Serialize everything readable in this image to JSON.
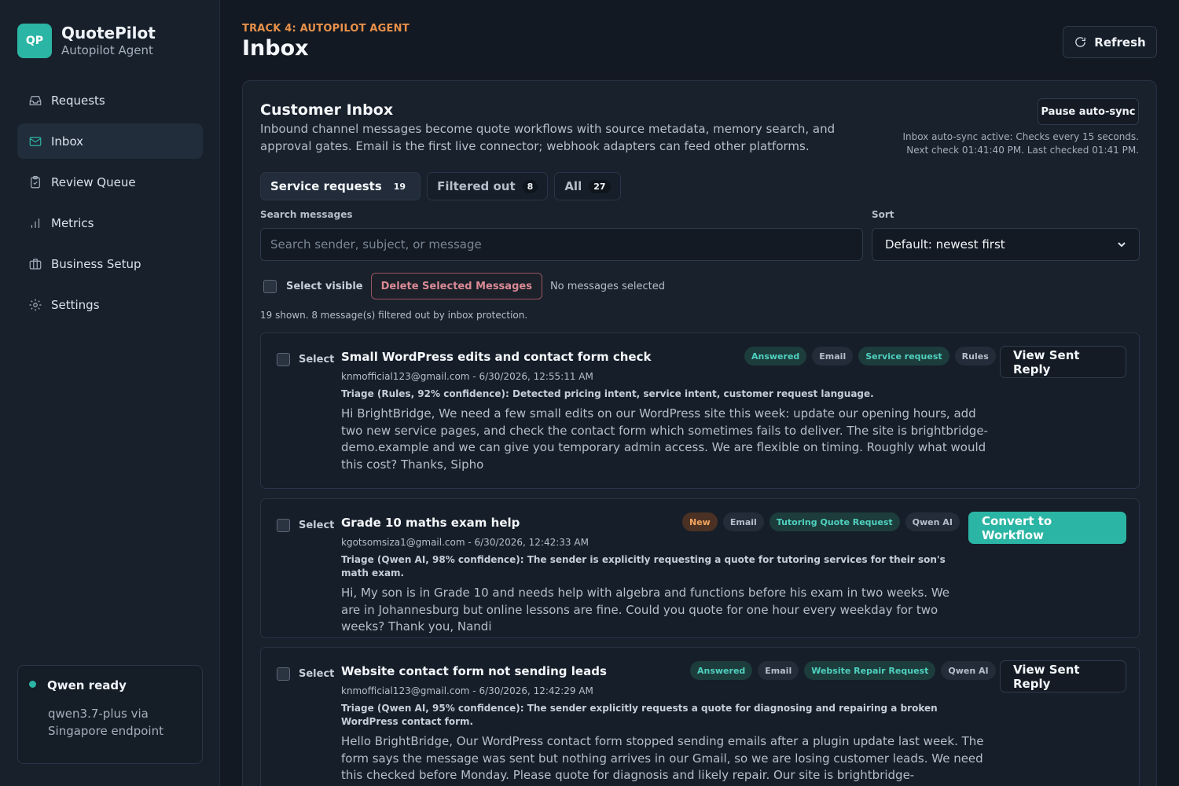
{
  "brand": {
    "logo": "QP",
    "name": "QuotePilot",
    "subtitle": "Autopilot Agent",
    "accent": "#2bb5a4"
  },
  "nav": [
    {
      "label": "Requests",
      "icon": "inbox-tray-icon",
      "active": false
    },
    {
      "label": "Inbox",
      "icon": "mail-icon",
      "active": true
    },
    {
      "label": "Review Queue",
      "icon": "clipboard-check-icon",
      "active": false
    },
    {
      "label": "Metrics",
      "icon": "bar-chart-icon",
      "active": false
    },
    {
      "label": "Business Setup",
      "icon": "briefcase-icon",
      "active": false
    },
    {
      "label": "Settings",
      "icon": "gear-icon",
      "active": false
    }
  ],
  "status": {
    "title": "Qwen ready",
    "desc": "qwen3.7-plus via Singapore endpoint"
  },
  "header": {
    "eyebrow": "TRACK 4: AUTOPILOT AGENT",
    "title": "Inbox",
    "refresh_label": "Refresh"
  },
  "panel": {
    "title": "Customer Inbox",
    "desc": "Inbound channel messages become quote workflows with source metadata, memory search, and approval gates. Email is the first live connector; webhook adapters can feed other platforms.",
    "pause_label": "Pause auto-sync",
    "sync_note": "Inbox auto-sync active: Checks every 15 seconds. Next check 01:41:40 PM. Last checked 01:41 PM."
  },
  "tabs": [
    {
      "label": "Service requests",
      "count": "19",
      "active": true
    },
    {
      "label": "Filtered out",
      "count": "8",
      "active": false
    },
    {
      "label": "All",
      "count": "27",
      "active": false
    }
  ],
  "search": {
    "label": "Search messages",
    "placeholder": "Search sender, subject, or message",
    "value": ""
  },
  "sort": {
    "label": "Sort",
    "value": "Default: newest first"
  },
  "bulk": {
    "select_label": "Select visible",
    "delete_label": "Delete Selected Messages",
    "selection_status": "No messages selected"
  },
  "summary": "19 shown. 8 message(s) filtered out by inbox protection.",
  "messages": [
    {
      "select_label": "Select",
      "subject": "Small WordPress edits and contact form check",
      "meta": "knmofficial123@gmail.com - 6/30/2026, 12:55:11 AM",
      "triage": "Triage (Rules, 92% confidence): Detected pricing intent, service intent, customer request language.",
      "body": "Hi BrightBridge, We need a few small edits on our WordPress site this week: update our opening hours, add two new service pages, and check the contact form which sometimes fails to deliver. The site is brightbridge-demo.example and we can give you temporary admin access. We are flexible on timing. Roughly what would this cost? Thanks, Sipho",
      "tags": [
        {
          "text": "Answered",
          "style": "teal"
        },
        {
          "text": "Email",
          "style": "gray"
        },
        {
          "text": "Service request",
          "style": "teal"
        },
        {
          "text": "Rules",
          "style": "gray"
        }
      ],
      "action": {
        "label": "View Sent Reply",
        "style": "outline"
      }
    },
    {
      "select_label": "Select",
      "subject": "Grade 10 maths exam help",
      "meta": "kgotsomsiza1@gmail.com - 6/30/2026, 12:42:33 AM",
      "triage": "Triage (Qwen AI, 98% confidence): The sender is explicitly requesting a quote for tutoring services for their son's math exam.",
      "body": "Hi, My son is in Grade 10 and needs help with algebra and functions before his exam in two weeks. We are in Johannesburg but online lessons are fine. Could you quote for one hour every weekday for two weeks? Thank you, Nandi",
      "tags": [
        {
          "text": "New",
          "style": "orange"
        },
        {
          "text": "Email",
          "style": "gray"
        },
        {
          "text": "Tutoring Quote Request",
          "style": "teal"
        },
        {
          "text": "Qwen AI",
          "style": "gray"
        }
      ],
      "action": {
        "label": "Convert to Workflow",
        "style": "solid"
      }
    },
    {
      "select_label": "Select",
      "subject": "Website contact form not sending leads",
      "meta": "knmofficial123@gmail.com - 6/30/2026, 12:42:29 AM",
      "triage": "Triage (Qwen AI, 95% confidence): The sender explicitly requests a quote for diagnosing and repairing a broken WordPress contact form.",
      "body": "Hello BrightBridge, Our WordPress contact form stopped sending emails after a plugin update last week. The form says the message was sent but nothing arrives in our Gmail, so we are losing customer leads. We need this checked before Monday. Please quote for diagnosis and likely repair. Our site is brightbridge-demo.example. Regards, Sipho",
      "tags": [
        {
          "text": "Answered",
          "style": "teal"
        },
        {
          "text": "Email",
          "style": "gray"
        },
        {
          "text": "Website Repair Request",
          "style": "teal"
        },
        {
          "text": "Qwen AI",
          "style": "gray"
        }
      ],
      "action": {
        "label": "View Sent Reply",
        "style": "outline"
      }
    }
  ]
}
